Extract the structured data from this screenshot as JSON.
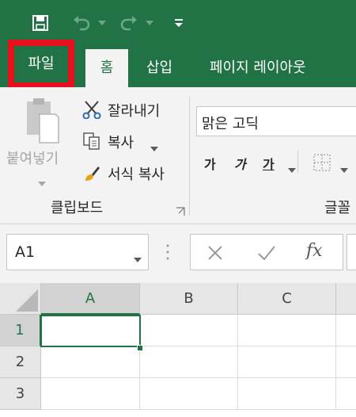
{
  "colors": {
    "brand": "#217346",
    "highlight": "#e8101c"
  },
  "qat": {
    "save_icon": "save-icon",
    "undo_icon": "undo-icon",
    "redo_icon": "redo-icon",
    "customize_icon": "customize-qat-icon"
  },
  "tabs": {
    "file": "파일",
    "home": "홈",
    "insert": "삽입",
    "page_layout": "페이지 레이아웃"
  },
  "clipboard": {
    "paste": "붙여넣기",
    "cut": "잘라내기",
    "copy": "복사",
    "format_painter": "서식 복사",
    "group_label": "클립보드"
  },
  "font": {
    "name": "맑은 고딕",
    "bold": "가",
    "italic": "가",
    "underline": "가",
    "group_label": "글꼴"
  },
  "formula_bar": {
    "name_box": "A1",
    "fx": "fx"
  },
  "sheet": {
    "columns": [
      "A",
      "B",
      "C"
    ],
    "rows": [
      "1",
      "2",
      "3"
    ],
    "selected_cell": "A1"
  }
}
